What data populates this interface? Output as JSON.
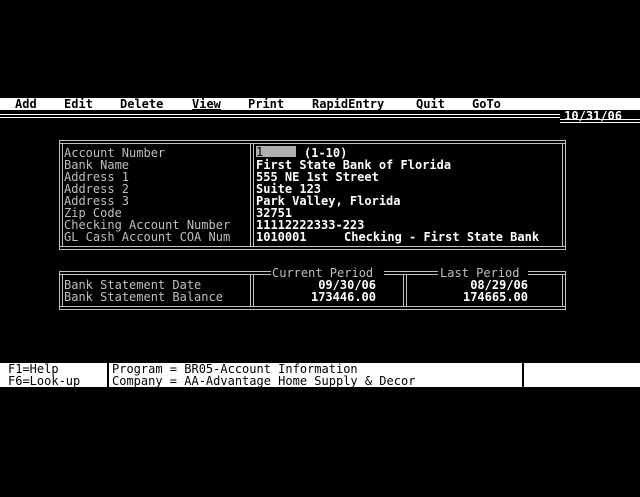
{
  "menu": {
    "items": [
      "Add",
      "Edit",
      "Delete",
      "View",
      "Print",
      "RapidEntry",
      "Quit",
      "GoTo"
    ],
    "active": "View"
  },
  "header": {
    "date": "10/31/06"
  },
  "account": {
    "labels": {
      "account_number": "Account Number",
      "bank_name": "Bank Name",
      "address1": "Address 1",
      "address2": "Address 2",
      "address3": "Address 3",
      "zip": "Zip Code",
      "checking": "Checking Account Number",
      "gl": "GL Cash Account COA Num"
    },
    "values": {
      "account_number": "1",
      "account_number_range": "(1-10)",
      "bank_name": "First State Bank of Florida",
      "address1": "555 NE 1st Street",
      "address2": "Suite 123",
      "address3": "Park Valley, Florida",
      "zip": "32751",
      "checking": "11112222333-223",
      "gl_code": "1010001",
      "gl_desc": "Checking - First State Bank"
    }
  },
  "statement": {
    "current_header": "Current Period",
    "last_header": "Last Period",
    "rows": [
      {
        "label": "Bank Statement Date",
        "current": "09/30/06",
        "last": "08/29/06"
      },
      {
        "label": "Bank Statement Balance",
        "current": "173446.00",
        "last": "174665.00"
      }
    ]
  },
  "status": {
    "keys": [
      "F1=Help",
      "F6=Look-up"
    ],
    "program": "Program = BR05-Account Information",
    "company": "Company = AA-Advantage Home Supply & Decor"
  }
}
